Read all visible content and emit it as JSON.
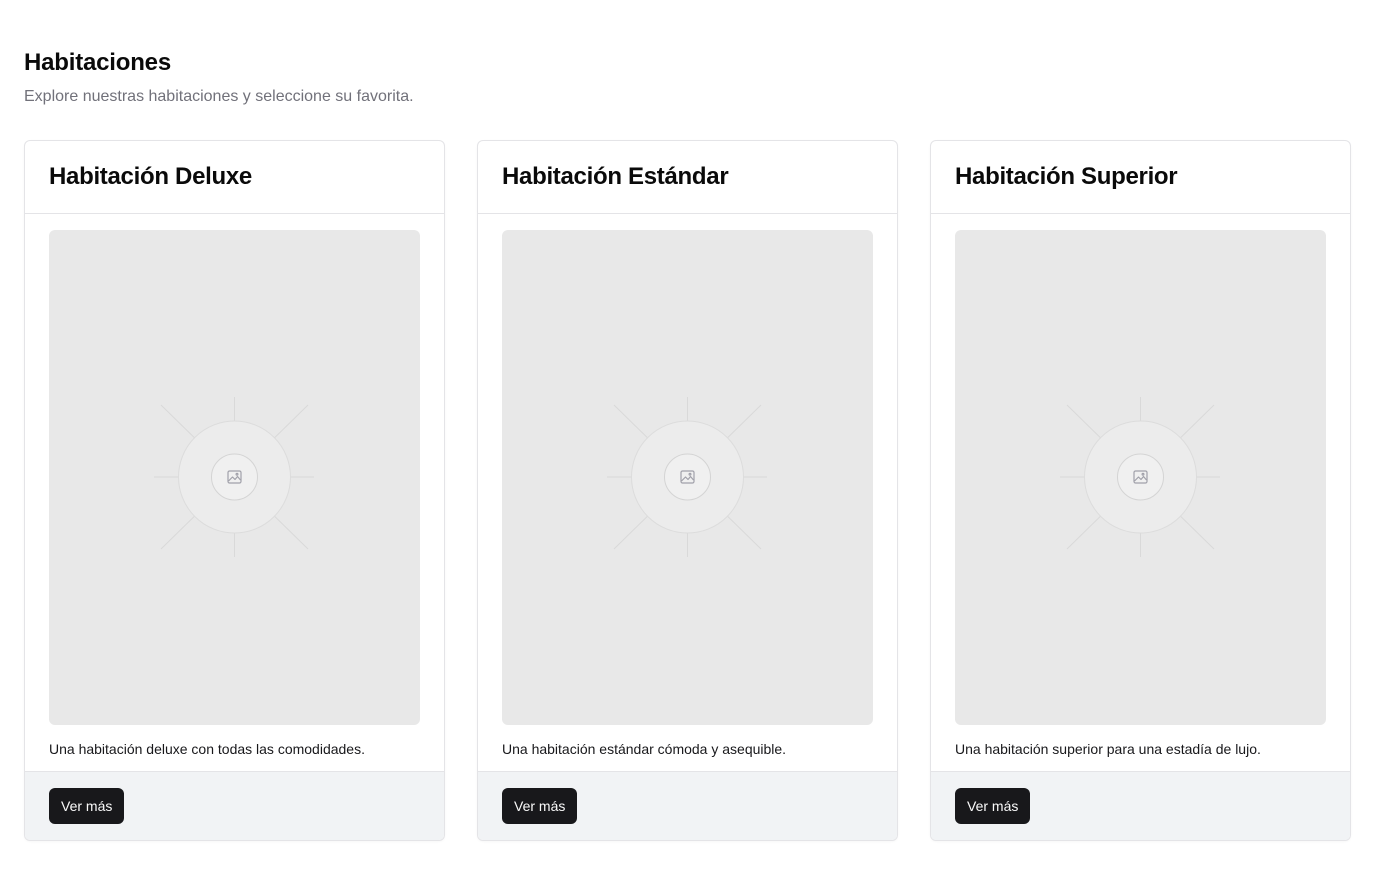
{
  "header": {
    "title": "Habitaciones",
    "subtitle": "Explore nuestras habitaciones y seleccione su favorita."
  },
  "rooms": [
    {
      "title": "Habitación Deluxe",
      "description": "Una habitación deluxe con todas las comodidades.",
      "button_label": "Ver más",
      "image_icon": "image-placeholder-icon"
    },
    {
      "title": "Habitación Estándar",
      "description": "Una habitación estándar cómoda y asequible.",
      "button_label": "Ver más",
      "image_icon": "image-placeholder-icon"
    },
    {
      "title": "Habitación Superior",
      "description": "Una habitación superior para una estadía de lujo.",
      "button_label": "Ver más",
      "image_icon": "image-placeholder-icon"
    }
  ],
  "colors": {
    "button_bg": "#18181b",
    "button_text": "#fafafa",
    "footer_bg": "#f1f3f5",
    "placeholder_bg": "#e8e8e8",
    "border": "#e4e4e7",
    "muted_text": "#71717a"
  }
}
